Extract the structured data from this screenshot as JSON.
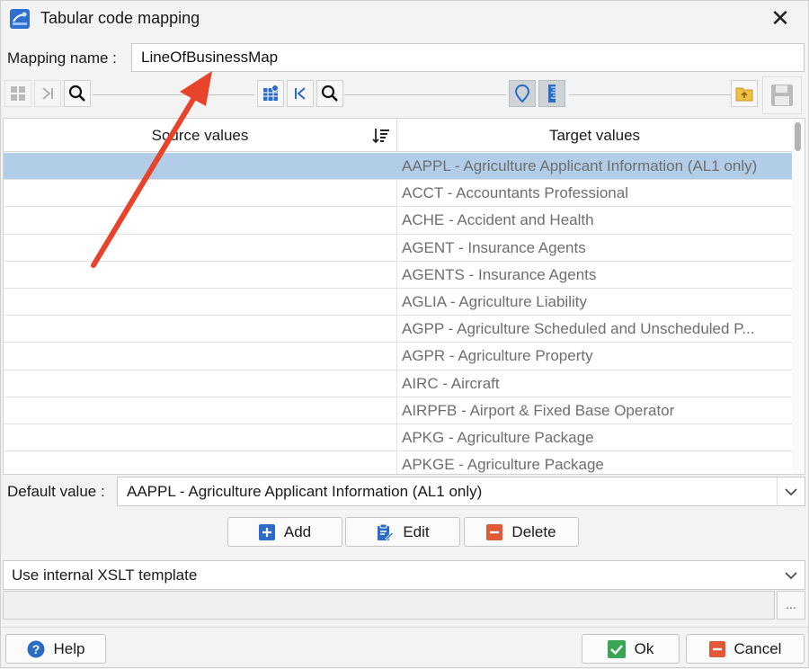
{
  "window": {
    "title": "Tabular code mapping",
    "close_glyph": "✕"
  },
  "mapping": {
    "label": "Mapping name :",
    "value": "LineOfBusinessMap"
  },
  "grid": {
    "source_header": "Source values",
    "target_header": "Target values",
    "rows": [
      {
        "source": "",
        "target": "AAPPL - Agriculture Applicant Information (AL1 only)",
        "selected": true
      },
      {
        "source": "",
        "target": "ACCT - Accountants Professional"
      },
      {
        "source": "",
        "target": "ACHE - Accident and Health"
      },
      {
        "source": "",
        "target": "AGENT - Insurance Agents"
      },
      {
        "source": "",
        "target": "AGENTS - Insurance Agents"
      },
      {
        "source": "",
        "target": "AGLIA - Agriculture Liability"
      },
      {
        "source": "",
        "target": "AGPP - Agriculture Scheduled and Unscheduled P..."
      },
      {
        "source": "",
        "target": "AGPR - Agriculture Property"
      },
      {
        "source": "",
        "target": "AIRC - Aircraft"
      },
      {
        "source": "",
        "target": "AIRPFB - Airport & Fixed Base Operator"
      },
      {
        "source": "",
        "target": "APKG - Agriculture Package"
      },
      {
        "source": "",
        "target": "APKGE - Agriculture Package"
      }
    ]
  },
  "default_value": {
    "label": "Default value :",
    "value": "AAPPL - Agriculture Applicant Information (AL1 only)"
  },
  "actions": {
    "add": "Add",
    "edit": "Edit",
    "delete": "Delete"
  },
  "xslt": {
    "value": "Use internal XSLT template",
    "browse": "..."
  },
  "footer": {
    "help": "Help",
    "ok": "Ok",
    "cancel": "Cancel"
  },
  "colors": {
    "accent": "#2b6cc4",
    "selection": "#b1cde8",
    "annotation_arrow": "#e8442c",
    "ok_green": "#3aa655",
    "delete_red": "#e05a3a"
  },
  "icons": [
    "app-icon",
    "close-icon",
    "grid-icon",
    "last-icon",
    "search-icon",
    "grid-add-icon",
    "first-icon",
    "search-icon",
    "location-icon",
    "ruler-icon",
    "folder-icon",
    "save-icon",
    "sort-icon",
    "chevron-down-icon",
    "plus-icon",
    "edit-icon",
    "minus-icon",
    "help-icon",
    "check-icon",
    "cancel-icon"
  ]
}
